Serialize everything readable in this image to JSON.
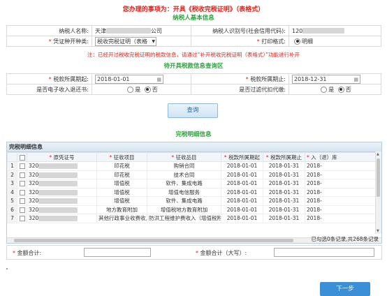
{
  "page_title": "您办理的事项为：开具《税收完税证明》（表格式）",
  "sections": {
    "basic": "纳税人基本信息",
    "query": "待开具税款信息查询区",
    "detail": "完税明细信息"
  },
  "basic_info": {
    "taxpayer_name_label": "纳税人名称:",
    "taxpayer_name_prefix": "天津",
    "taxpayer_name_suffix": "公司",
    "taxpayer_id_label": "纳税人识别号(社会信用代码):",
    "taxpayer_id_prefix": "120",
    "voucher_type_label": "凭证种开种类:",
    "voucher_type_value": "税收完税证明（表格",
    "print_format_label": "打印格式:",
    "print_format_value": "明细"
  },
  "notice": "注：已经开过税收完税证明的税款信息，请通过“补开税收完税证明（表格式）”功能进行补开",
  "query": {
    "start_label": "税款所属期起:",
    "start_value": "2018-01-01",
    "end_label": "税款所属期止:",
    "end_value": "2018-12-31",
    "electronic_refund_label": "是否电子收入退还书:",
    "withholding_label": "是否过滤代扣代缴:",
    "yes": "是",
    "no": "否",
    "button": "查询"
  },
  "grid": {
    "caption": "完税明细信息",
    "columns": [
      "原凭证号",
      "征收项目",
      "征收品目",
      "税款所属期起",
      "税款所属期止",
      "入（退）库"
    ],
    "required_cols": [
      true,
      true,
      true,
      true,
      true,
      true
    ],
    "rows": [
      {
        "num": "1",
        "voucher": "320",
        "item": "印花税",
        "subitem": "购销合同",
        "start": "2018-01-01",
        "end": "2018-01-31",
        "entry": "2018-"
      },
      {
        "num": "2",
        "voucher": "320",
        "item": "印花税",
        "subitem": "技术合同",
        "start": "2018-01-01",
        "end": "2018-01-31",
        "entry": "2018-"
      },
      {
        "num": "3",
        "voucher": "320",
        "item": "增值税",
        "subitem": "软件、集成电路",
        "start": "2018-01-01",
        "end": "2018-01-31",
        "entry": "2018-"
      },
      {
        "num": "4",
        "voucher": "320",
        "item": "增值税",
        "subitem": "增值电信服务",
        "start": "2018-01-01",
        "end": "2018-01-31",
        "entry": "2018-"
      },
      {
        "num": "5",
        "voucher": "320",
        "item": "增值税",
        "subitem": "软件、集成电路",
        "start": "2018-01-01",
        "end": "2018-01-31",
        "entry": "2018-"
      },
      {
        "num": "6",
        "voucher": "320",
        "item": "地方教育附加",
        "subitem": "增值税地方教育附加",
        "start": "2018-01-01",
        "end": "2018-01-31",
        "entry": "2018-"
      },
      {
        "num": "7",
        "voucher": "320",
        "item": "其他行政事业收费收入",
        "subitem": "防洪工程维护费收入（增值税附征）",
        "start": "2018-01-01",
        "end": "2018-01-31",
        "entry": "2018-"
      }
    ]
  },
  "selected_summary": "已勾选0条记录,共268条记录",
  "sum": {
    "amount_label": "金额合计:",
    "amount_upper_label": "金额合计（大写）:"
  },
  "next_button": "下一步"
}
